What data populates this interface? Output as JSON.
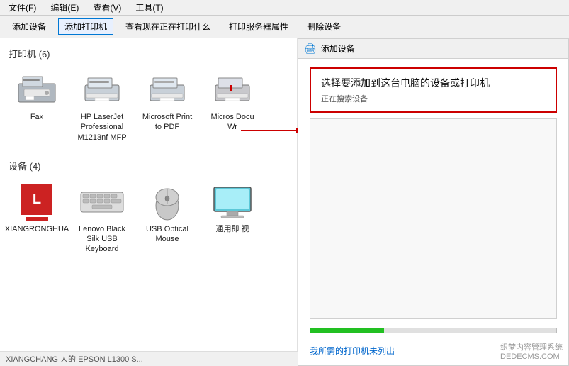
{
  "menu": {
    "items": [
      {
        "label": "文件(F)"
      },
      {
        "label": "编辑(E)"
      },
      {
        "label": "查看(V)"
      },
      {
        "label": "工具(T)"
      }
    ]
  },
  "toolbar": {
    "buttons": [
      {
        "label": "添加设备",
        "active": false
      },
      {
        "label": "添加打印机",
        "active": true
      },
      {
        "label": "查看现在正在打印什么",
        "active": false
      },
      {
        "label": "打印服务器属性",
        "active": false
      },
      {
        "label": "删除设备",
        "active": false
      }
    ]
  },
  "printers_section": {
    "header": "打印机 (6)",
    "devices": [
      {
        "label": "Fax",
        "type": "fax"
      },
      {
        "label": "HP LaserJet Professional M1213nf MFP",
        "type": "printer"
      },
      {
        "label": "Microsoft Print to PDF",
        "type": "printer"
      },
      {
        "label": "Micros Docu Wr",
        "type": "printer"
      }
    ]
  },
  "devices_section": {
    "header": "设备 (4)",
    "devices": [
      {
        "label": "XIANGRONGHUA",
        "type": "red-square"
      },
      {
        "label": "Lenovo Black Silk USB Keyboard",
        "type": "keyboard"
      },
      {
        "label": "USB Optical Mouse",
        "type": "mouse"
      },
      {
        "label": "通用即 视",
        "type": "monitor"
      }
    ]
  },
  "dialog": {
    "title": "添加设备",
    "prompt_title": "选择要添加到这台电脑的设备或打印机",
    "prompt_subtitle": "正在搜索设备",
    "not_listed": "我所需的打印机未列出",
    "progress": 30
  },
  "watermark": {
    "line1": "织梦内容管理系统",
    "line2": "DEDECMS.COM"
  },
  "bottom_bar": {
    "text": "XIANGCHANG 人的 EPSON L1300 S..."
  }
}
